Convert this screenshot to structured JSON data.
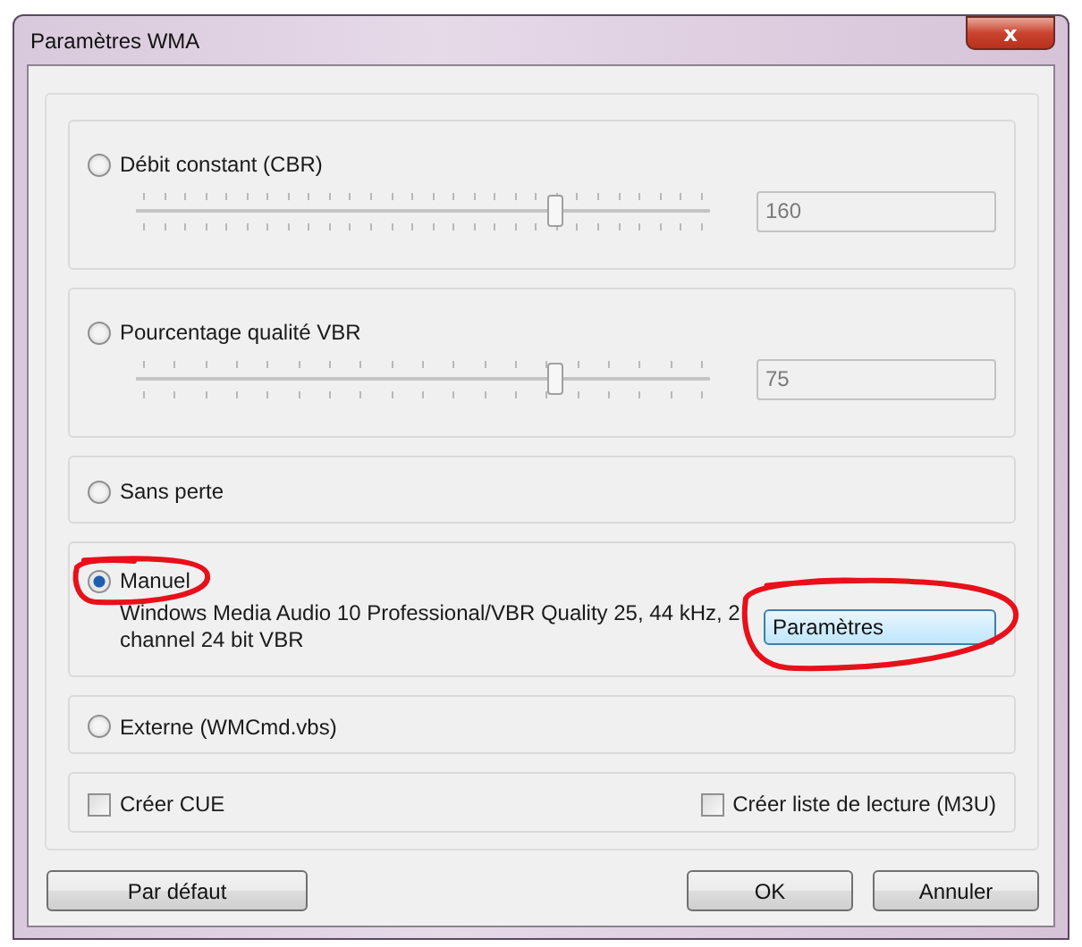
{
  "window": {
    "title": "Paramètres WMA",
    "close_label": "x"
  },
  "modes": [
    {
      "kind": "slider",
      "label": "Débit constant (CBR)",
      "selected": false,
      "level": 0.73,
      "value": "160"
    },
    {
      "kind": "slider",
      "label": "Pourcentage qualité VBR",
      "selected": false,
      "level": 0.73,
      "value": "75"
    },
    {
      "kind": "plain",
      "label": "Sans perte",
      "selected": false
    },
    {
      "kind": "manual",
      "label": "Manuel",
      "selected": true,
      "annotated": true,
      "description": "Windows Media Audio 10 Professional/VBR Quality 25, 44 kHz, 2 channel 24 bit VBR",
      "button": {
        "label": "Paramètres",
        "annotated": true
      }
    },
    {
      "kind": "plain",
      "label": "Externe (WMCmd.vbs)",
      "selected": false
    }
  ],
  "options": [
    {
      "label": "Créer CUE",
      "checked": false
    },
    {
      "label": "Créer liste de lecture (M3U)",
      "checked": false
    }
  ],
  "buttons": [
    {
      "label": "Par défaut"
    },
    {
      "label": "OK"
    },
    {
      "label": "Annuler"
    }
  ]
}
